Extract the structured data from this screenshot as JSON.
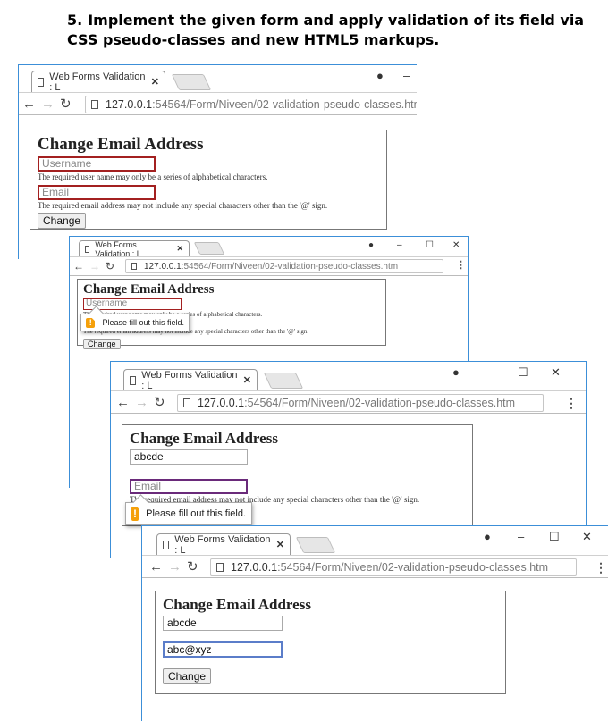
{
  "heading": {
    "number": "5.",
    "text": "Implement the given form and apply validation of its field via CSS pseudo-classes and new HTML5 markups."
  },
  "browser": {
    "tab_title": "Web Forms Validation : L",
    "url_host": "127.0.0.1",
    "url_path": ":54564/Form/Niveen/02-validation-pseudo-classes.htm"
  },
  "form": {
    "title": "Change Email Address",
    "username_placeholder": "Username",
    "email_placeholder": "Email",
    "username_hint": "The required user name may only be a series of alphabetical characters.",
    "email_hint": "The required email address may not include any special characters other than the '@' sign.",
    "button": "Change",
    "username_value": "abcde",
    "email_value": "abc@xyz"
  },
  "tooltip": {
    "message": "Please fill out this field."
  },
  "colors": {
    "error_border": "#a32020",
    "focus_border": "#5b7dc9",
    "warning": "#f5a00a",
    "frame": "#3c8fd8"
  }
}
